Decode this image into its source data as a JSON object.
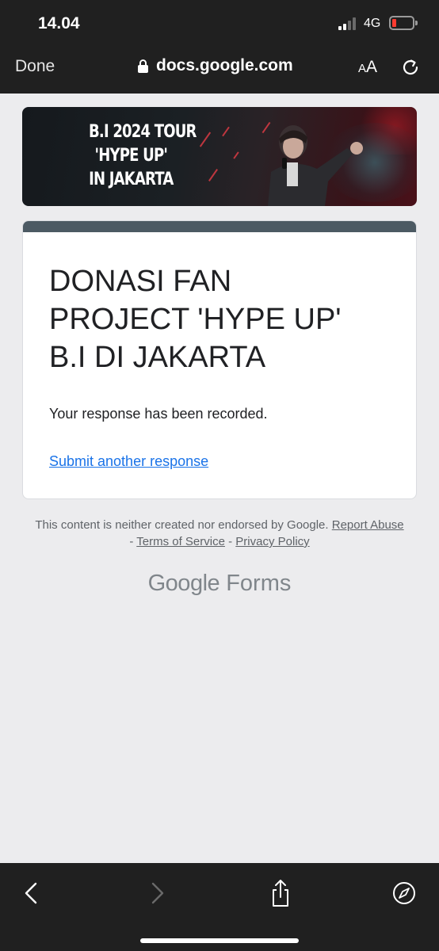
{
  "status_bar": {
    "time": "14.04",
    "network": "4G"
  },
  "nav_bar": {
    "done_label": "Done",
    "url": "docs.google.com",
    "text_size_label_small": "A",
    "text_size_label_large": "A"
  },
  "banner": {
    "lines": [
      "B.I 2024 TOUR",
      "'HYPE UP'",
      "IN JAKARTA"
    ]
  },
  "form": {
    "title_lines": [
      "DONASI FAN",
      "PROJECT 'HYPE UP'",
      "B.I DI JAKARTA"
    ],
    "response_message": "Your response has been recorded.",
    "submit_another_label": "Submit another response"
  },
  "footer": {
    "disclaimer": "This content is neither created nor endorsed by Google.",
    "report_abuse": "Report Abuse",
    "separator": " - ",
    "terms": "Terms of Service",
    "privacy": "Privacy Policy",
    "brand_google": "Google",
    "brand_forms": "Forms"
  },
  "colors": {
    "bar_bg": "#202020",
    "page_bg": "#ececee",
    "card_accent": "#4c5a63",
    "link": "#1a73e8",
    "battery_low": "#ff3b30"
  },
  "icons": {
    "lock": "lock-icon",
    "reload": "reload-icon",
    "back": "chevron-left-icon",
    "forward": "chevron-right-icon",
    "share": "share-icon",
    "compass": "compass-icon"
  }
}
